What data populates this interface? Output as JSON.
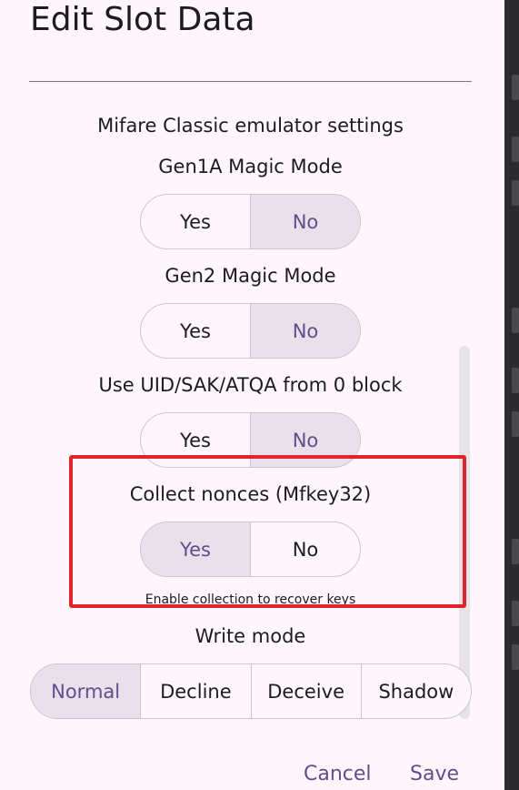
{
  "dialog": {
    "title": "Edit Slot Data",
    "actions": {
      "cancel_label": "Cancel",
      "save_label": "Save"
    }
  },
  "settings": {
    "section_title": "Mifare Classic emulator settings",
    "gen1a": {
      "label": "Gen1A Magic Mode",
      "options": [
        "Yes",
        "No"
      ],
      "selected": "No"
    },
    "gen2": {
      "label": "Gen2 Magic Mode",
      "options": [
        "Yes",
        "No"
      ],
      "selected": "No"
    },
    "uid_from_block0": {
      "label": "Use UID/SAK/ATQA from 0 block",
      "options": [
        "Yes",
        "No"
      ],
      "selected": "No"
    },
    "collect_nonces": {
      "label": "Collect nonces (Mfkey32)",
      "options": [
        "Yes",
        "No"
      ],
      "selected": "Yes",
      "helper": "Enable collection to recover keys"
    },
    "write_mode": {
      "label": "Write mode",
      "options": [
        "Normal",
        "Decline",
        "Deceive",
        "Shadow"
      ],
      "selected": "Normal"
    }
  },
  "colors": {
    "accent": "#5e4f8c",
    "selected_segment": "#e8e0eb",
    "highlight_border": "#e0242b",
    "surface": "#fdf7fb"
  }
}
